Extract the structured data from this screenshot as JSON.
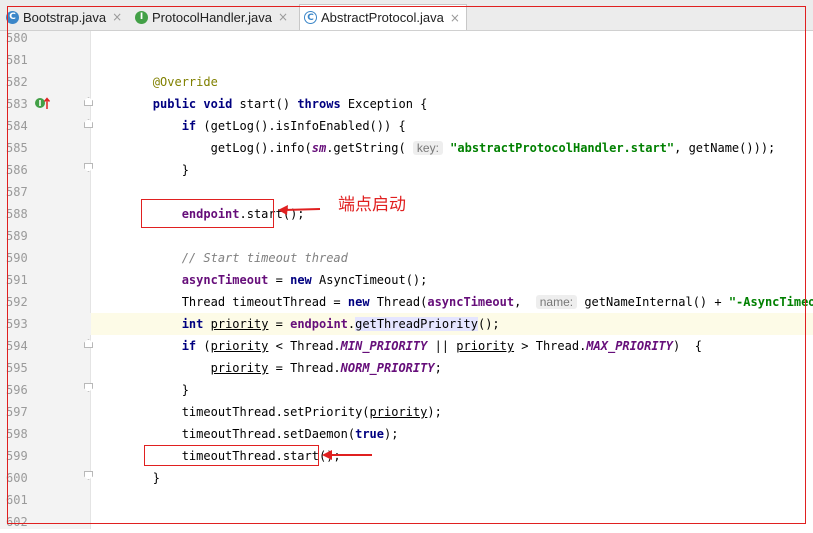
{
  "tabs": [
    {
      "label": "Bootstrap.java",
      "icon": "class-icon",
      "glyph": "C"
    },
    {
      "label": "ProtocolHandler.java",
      "icon": "interface-icon",
      "glyph": "I"
    },
    {
      "label": "AbstractProtocol.java",
      "icon": "abstract-class-icon",
      "glyph": "C"
    }
  ],
  "tab_close_glyph": "×",
  "lines": [
    {
      "num": "580",
      "tokens": []
    },
    {
      "num": "581",
      "tokens": []
    },
    {
      "num": "582",
      "tokens": [
        {
          "t": "        "
        },
        {
          "t": "@Override",
          "c": "ann"
        }
      ]
    },
    {
      "num": "583",
      "tokens": [
        {
          "t": "        "
        },
        {
          "t": "public",
          "c": "kw"
        },
        {
          "t": " "
        },
        {
          "t": "void",
          "c": "kw"
        },
        {
          "t": " start() "
        },
        {
          "t": "throws",
          "c": "kw"
        },
        {
          "t": " Exception {"
        }
      ]
    },
    {
      "num": "584",
      "tokens": [
        {
          "t": "            "
        },
        {
          "t": "if",
          "c": "kw"
        },
        {
          "t": " (getLog().isInfoEnabled()) {"
        }
      ]
    },
    {
      "num": "585",
      "tokens": [
        {
          "t": "                getLog().info("
        },
        {
          "t": "sm",
          "c": "sfld"
        },
        {
          "t": ".getString( "
        },
        {
          "t": "key:",
          "c": "hint"
        },
        {
          "t": " "
        },
        {
          "t": "\"abstractProtocolHandler.start\"",
          "c": "str"
        },
        {
          "t": ", getName()));"
        }
      ]
    },
    {
      "num": "586",
      "tokens": [
        {
          "t": "            }"
        }
      ]
    },
    {
      "num": "587",
      "tokens": []
    },
    {
      "num": "588",
      "tokens": [
        {
          "t": "            "
        },
        {
          "t": "endpoint",
          "c": "fld"
        },
        {
          "t": ".start();"
        }
      ]
    },
    {
      "num": "589",
      "tokens": []
    },
    {
      "num": "590",
      "tokens": [
        {
          "t": "            "
        },
        {
          "t": "// Start timeout thread",
          "c": "cmt"
        }
      ]
    },
    {
      "num": "591",
      "tokens": [
        {
          "t": "            "
        },
        {
          "t": "asyncTimeout",
          "c": "fld"
        },
        {
          "t": " = "
        },
        {
          "t": "new",
          "c": "kw"
        },
        {
          "t": " AsyncTimeout();"
        }
      ]
    },
    {
      "num": "592",
      "tokens": [
        {
          "t": "            Thread timeoutThread = "
        },
        {
          "t": "new",
          "c": "kw"
        },
        {
          "t": " Thread("
        },
        {
          "t": "asyncTimeout",
          "c": "fld"
        },
        {
          "t": ",  "
        },
        {
          "t": "name:",
          "c": "hint"
        },
        {
          "t": " getNameInternal() + "
        },
        {
          "t": "\"-AsyncTimeout\"",
          "c": "str"
        },
        {
          "t": ");"
        }
      ]
    },
    {
      "num": "593",
      "tokens": [
        {
          "t": "            "
        },
        {
          "t": "int",
          "c": "kw"
        },
        {
          "t": " "
        },
        {
          "t": "priority",
          "c": "und"
        },
        {
          "t": " = "
        },
        {
          "t": "endpoint",
          "c": "fld"
        },
        {
          "t": "."
        },
        {
          "t": "getThreadPriority",
          "c": "hlbox"
        },
        {
          "t": "();"
        }
      ]
    },
    {
      "num": "594",
      "tokens": [
        {
          "t": "            "
        },
        {
          "t": "if",
          "c": "kw"
        },
        {
          "t": " ("
        },
        {
          "t": "priority",
          "c": "und"
        },
        {
          "t": " < Thread."
        },
        {
          "t": "MIN_PRIORITY",
          "c": "sfld"
        },
        {
          "t": " || "
        },
        {
          "t": "priority",
          "c": "und"
        },
        {
          "t": " > Thread."
        },
        {
          "t": "MAX_PRIORITY",
          "c": "sfld"
        },
        {
          "t": ")  {"
        }
      ]
    },
    {
      "num": "595",
      "tokens": [
        {
          "t": "                "
        },
        {
          "t": "priority",
          "c": "und"
        },
        {
          "t": " = Thread."
        },
        {
          "t": "NORM_PRIORITY",
          "c": "sfld"
        },
        {
          "t": ";"
        }
      ]
    },
    {
      "num": "596",
      "tokens": [
        {
          "t": "            }"
        }
      ]
    },
    {
      "num": "597",
      "tokens": [
        {
          "t": "            timeoutThread.setPriority("
        },
        {
          "t": "priority",
          "c": "und"
        },
        {
          "t": ");"
        }
      ]
    },
    {
      "num": "598",
      "tokens": [
        {
          "t": "            timeoutThread.setDaemon("
        },
        {
          "t": "true",
          "c": "kw"
        },
        {
          "t": ");"
        }
      ]
    },
    {
      "num": "599",
      "tokens": [
        {
          "t": "            timeoutThread.start();"
        }
      ]
    },
    {
      "num": "600",
      "tokens": [
        {
          "t": "        }"
        }
      ]
    },
    {
      "num": "601",
      "tokens": []
    },
    {
      "num": "602",
      "tokens": []
    }
  ],
  "highlighted_line": "593",
  "annotation": {
    "text": "端点启动",
    "color": "#e02020"
  },
  "colors": {
    "keyword": "#000080",
    "field": "#660e7a",
    "string": "#008000",
    "annotation": "#808000",
    "comment": "#808080",
    "accent_red": "#e02020"
  }
}
